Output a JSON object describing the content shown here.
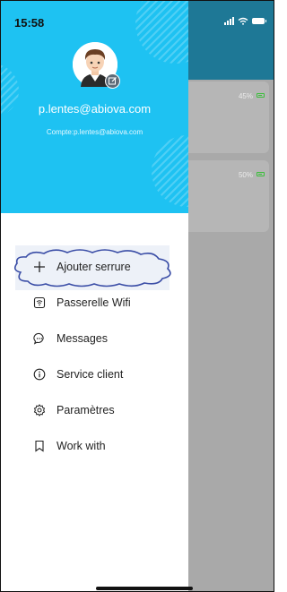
{
  "status_bar": {
    "time": "15:58"
  },
  "background_app": {
    "devices": [
      {
        "battery": "45%"
      },
      {
        "battery": "50%"
      }
    ]
  },
  "drawer": {
    "email": "p.lentes@abiova.com",
    "account": "Compte:p.lentes@abiova.com",
    "header_color": "#1ec2f2",
    "menu": [
      {
        "label": "Ajouter serrure",
        "icon": "plus-icon"
      },
      {
        "label": "Passerelle Wifi",
        "icon": "wifi-gateway-icon"
      },
      {
        "label": "Messages",
        "icon": "message-icon"
      },
      {
        "label": "Service client",
        "icon": "info-icon"
      },
      {
        "label": "Paramètres",
        "icon": "gear-icon"
      },
      {
        "label": "Work with",
        "icon": "bookmark-icon"
      }
    ]
  }
}
